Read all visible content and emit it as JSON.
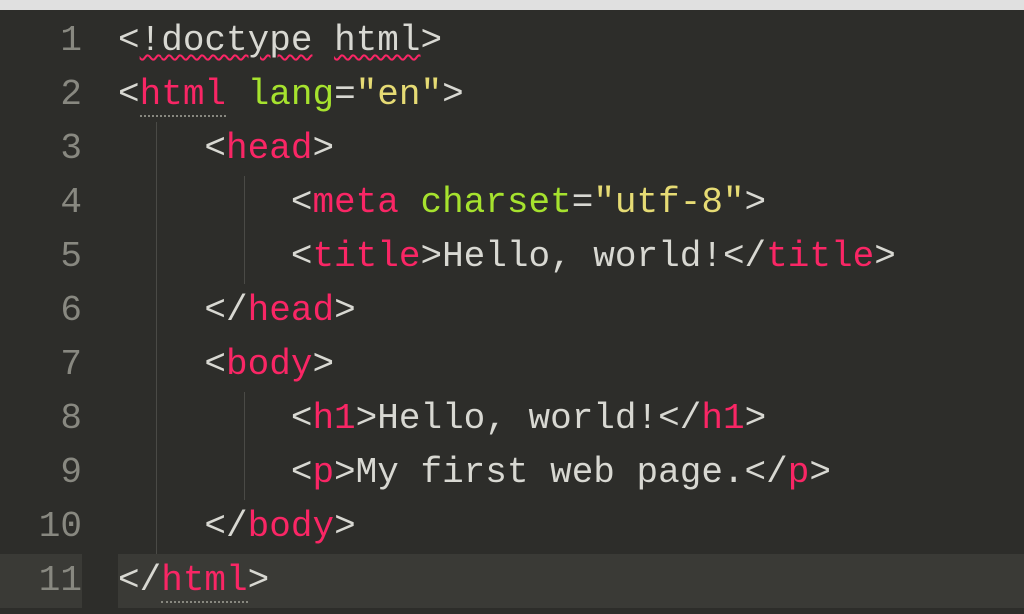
{
  "gutter": {
    "lines": [
      "1",
      "2",
      "3",
      "4",
      "5",
      "6",
      "7",
      "8",
      "9",
      "10",
      "11"
    ],
    "active_line": 11
  },
  "code": {
    "l1": {
      "open": "<",
      "doctype_bang": "!",
      "doctype_word": "doctype",
      "space": " ",
      "html_word": "html",
      "close": ">"
    },
    "l2": {
      "open": "<",
      "tag": "html",
      "space": " ",
      "attr": "lang",
      "eq": "=",
      "val": "\"en\"",
      "close": ">"
    },
    "l3": {
      "indent": "    ",
      "open": "<",
      "tag": "head",
      "close": ">"
    },
    "l4": {
      "indent": "        ",
      "open": "<",
      "tag": "meta",
      "space": " ",
      "attr": "charset",
      "eq": "=",
      "val": "\"utf-8\"",
      "close": ">"
    },
    "l5": {
      "indent": "        ",
      "open": "<",
      "tag": "title",
      "close1": ">",
      "text": "Hello, world!",
      "open2": "</",
      "tag2": "title",
      "close2": ">"
    },
    "l6": {
      "indent": "    ",
      "open": "</",
      "tag": "head",
      "close": ">"
    },
    "l7": {
      "indent": "    ",
      "open": "<",
      "tag": "body",
      "close": ">"
    },
    "l8": {
      "indent": "        ",
      "open": "<",
      "tag": "h1",
      "close1": ">",
      "text": "Hello, world!",
      "open2": "</",
      "tag2": "h1",
      "close2": ">"
    },
    "l9": {
      "indent": "        ",
      "open": "<",
      "tag": "p",
      "close1": ">",
      "text": "My first web page.",
      "open2": "</",
      "tag2": "p",
      "close2": ">"
    },
    "l10": {
      "indent": "    ",
      "open": "</",
      "tag": "body",
      "close": ">"
    },
    "l11": {
      "open": "</",
      "tag": "html",
      "close": ">"
    }
  }
}
